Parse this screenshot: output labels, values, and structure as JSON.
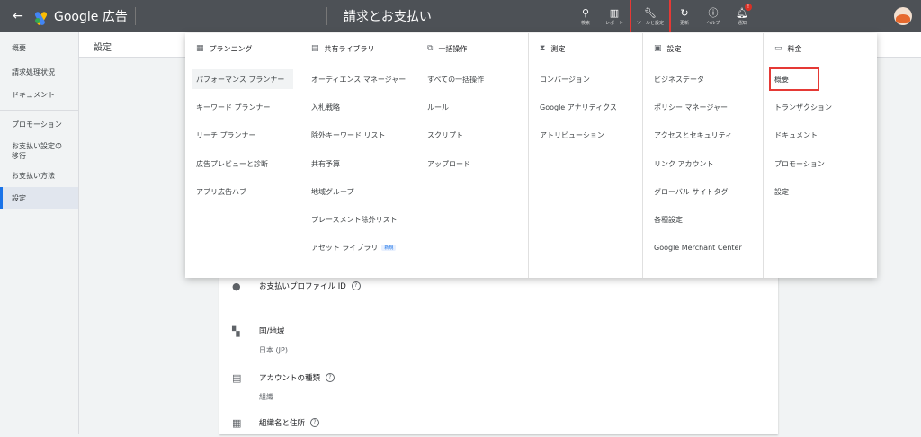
{
  "topbar": {
    "back_icon": "arrow-left-icon",
    "logo_text": "Google 広告",
    "account_line1": "",
    "account_line2_left": "",
    "account_line2_right": "",
    "page_title": "請求とお支払い",
    "tools": [
      {
        "name": "search",
        "icon": "magnifier-icon",
        "label": "検索"
      },
      {
        "name": "reports",
        "icon": "chart-icon",
        "label": "レポート"
      },
      {
        "name": "tools-settings",
        "icon": "wrench-icon",
        "label": "ツールと設定"
      },
      {
        "name": "refresh",
        "icon": "refresh-icon",
        "label": "更新"
      },
      {
        "name": "help",
        "icon": "help-icon",
        "label": "ヘルプ"
      },
      {
        "name": "notifications",
        "icon": "bell-icon",
        "label": "通知",
        "badge": "!"
      }
    ],
    "user_line1": "",
    "user_line2": ""
  },
  "sidebar": {
    "items": [
      {
        "label": "概要"
      },
      {
        "label": "請求処理状況"
      },
      {
        "label": "ドキュメント"
      },
      {
        "label": "プロモーション"
      },
      {
        "label": "お支払い設定の移行"
      },
      {
        "label": "お支払い方法"
      },
      {
        "label": "設定",
        "active": true
      }
    ]
  },
  "page_header": {
    "title": "設定"
  },
  "menu": {
    "columns": [
      {
        "head": "プランニング",
        "icon": "calendar-icon",
        "items": [
          "パフォーマンス プランナー",
          "キーワード プランナー",
          "リーチ プランナー",
          "広告プレビューと診断",
          "アプリ広告ハブ"
        ]
      },
      {
        "head": "共有ライブラリ",
        "icon": "library-icon",
        "items": [
          "オーディエンス マネージャー",
          "入札戦略",
          "除外キーワード リスト",
          "共有予算",
          "地域グループ",
          "プレースメント除外リスト",
          "アセット ライブラリ"
        ],
        "new_badge": "新規"
      },
      {
        "head": "一括操作",
        "icon": "bulk-icon",
        "items": [
          "すべての一括操作",
          "ルール",
          "スクリプト",
          "アップロード"
        ]
      },
      {
        "head": "測定",
        "icon": "hourglass-icon",
        "items": [
          "コンバージョン",
          "Google アナリティクス",
          "アトリビューション"
        ]
      },
      {
        "head": "設定",
        "icon": "settings-box-icon",
        "items": [
          "ビジネスデータ",
          "ポリシー マネージャー",
          "アクセスとセキュリティ",
          "リンク アカウント",
          "グローバル サイトタグ",
          "各種設定",
          "Google Merchant Center"
        ]
      },
      {
        "head": "料金",
        "icon": "card-icon",
        "items": [
          "概要",
          "トランザクション",
          "ドキュメント",
          "プロモーション",
          "設定"
        ]
      }
    ]
  },
  "card": {
    "fields": [
      {
        "icon": "account-circle-icon",
        "label": "お支払いプロファイル ID",
        "help": true,
        "value": ""
      },
      {
        "icon": "map-icon",
        "label": "国/地域",
        "help": false,
        "value": "日本 (JP)"
      },
      {
        "icon": "id-card-icon",
        "label": "アカウントの種類",
        "help": true,
        "value": "組織"
      },
      {
        "icon": "building-icon",
        "label": "組織名と住所",
        "help": true,
        "value": ""
      }
    ]
  }
}
